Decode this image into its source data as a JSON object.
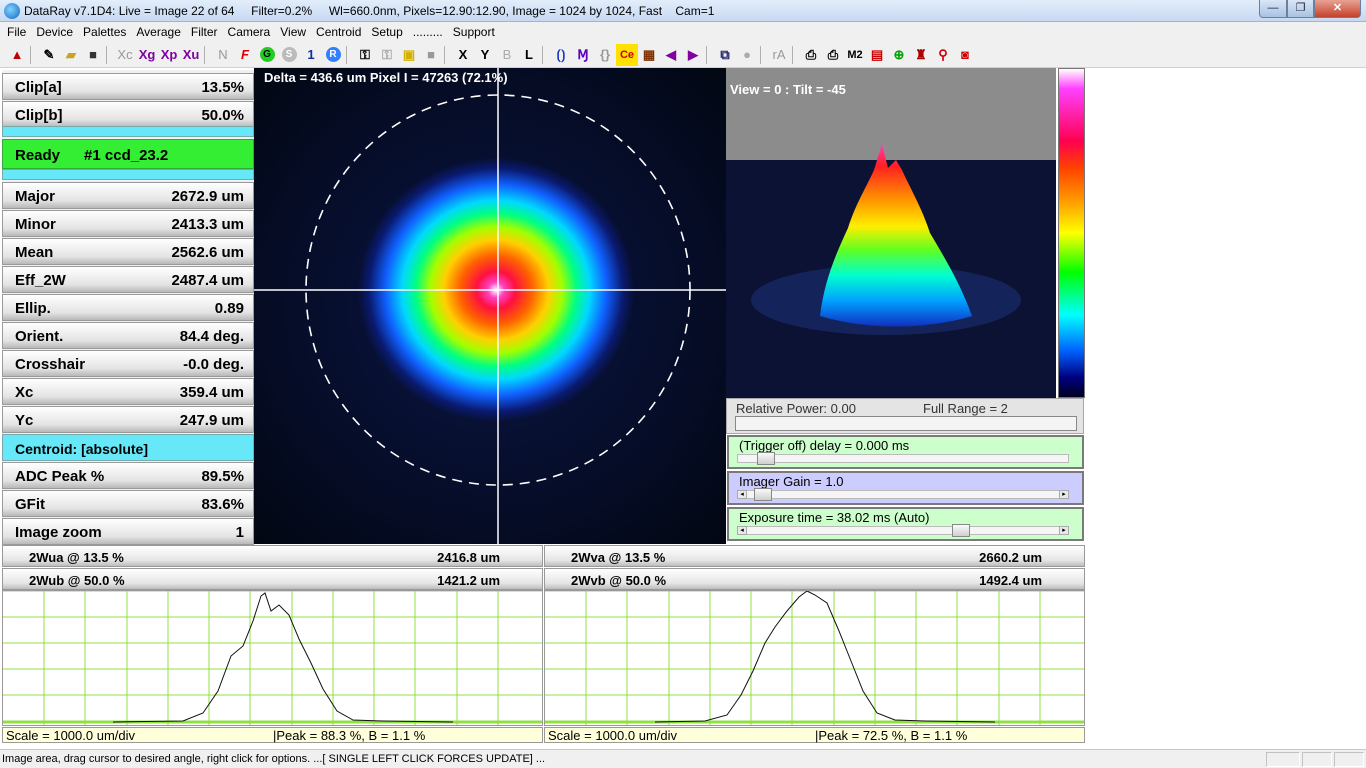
{
  "window": {
    "title": "DataRay v7.1D4: Live = Image 22 of 64     Filter=0.2%     Wl=660.0nm, Pixels=12.90:12.90, Image = 1024 by 1024, Fast    Cam=1",
    "min_label": "—",
    "max_label": "❐",
    "close_label": "✕"
  },
  "menu": [
    "File",
    "Device",
    "Palettes",
    "Average",
    "Filter",
    "Camera",
    "View",
    "Centroid",
    "Setup",
    ".........",
    "Support"
  ],
  "toolbar": {
    "xc": "Xc",
    "xg": "Xg",
    "xp": "Xp",
    "xu": "Xu",
    "n": "N",
    "f": "F",
    "g": "G",
    "s": "S",
    "one": "1",
    "r": "R",
    "x": "X",
    "y": "Y",
    "b": "B",
    "l": "L",
    "ce": "Ce",
    "ra": "rA",
    "m2": "M2"
  },
  "left_panel": {
    "clip_a": {
      "label": "Clip[a]",
      "value": "13.5%"
    },
    "clip_b": {
      "label": "Clip[b]",
      "value": "50.0%"
    },
    "status": {
      "label": "Ready",
      "value": "#1 ccd_23.2"
    },
    "major": {
      "label": "Major",
      "value": "2672.9 um"
    },
    "minor": {
      "label": "Minor",
      "value": "2413.3 um"
    },
    "mean": {
      "label": "Mean",
      "value": "2562.6 um"
    },
    "eff_2w": {
      "label": "Eff_2W",
      "value": "2487.4 um"
    },
    "ellip": {
      "label": "Ellip.",
      "value": "0.89"
    },
    "orient": {
      "label": "Orient.",
      "value": "84.4 deg."
    },
    "crosshair": {
      "label": "Crosshair",
      "value": "-0.0 deg."
    },
    "xc": {
      "label": "Xc",
      "value": "359.4 um"
    },
    "yc": {
      "label": "Yc",
      "value": "247.9 um"
    },
    "centroid": "Centroid: [absolute]",
    "adc_peak": {
      "label": "ADC Peak %",
      "value": "89.5%"
    },
    "gfit": {
      "label": "GFit",
      "value": "83.6%"
    },
    "image_zoom": {
      "label": "Image zoom",
      "value": "1"
    }
  },
  "beam": {
    "delta_text": "Delta = 436.6 um Pixel I = 47263 (72.1%)"
  },
  "view3d": {
    "label": "View = 0 : Tilt = -45"
  },
  "relative_power": {
    "label": "Relative Power: 0.00",
    "full_range": "Full Range = 2"
  },
  "controls": {
    "trigger": {
      "label": "(Trigger off) delay = 0.000 ms",
      "color": "#ccffcc",
      "position": 0.06
    },
    "gain": {
      "label": "Imager Gain = 1.0",
      "color": "#ccccff",
      "position": 0.05
    },
    "exposure": {
      "label": "Exposure time = 38.02 ms (Auto)",
      "color": "#ccffcc",
      "position": 0.68
    }
  },
  "profiles": {
    "u": {
      "wa_label": "2Wua @ 13.5 %",
      "wa_value": "2416.8 um",
      "wb_label": "2Wub @ 50.0 %",
      "wb_value": "1421.2 um",
      "scale": "Scale = 1000.0 um/div",
      "peak": "|Peak = 88.3 %,  B = 1.1 %"
    },
    "v": {
      "wa_label": "2Wva @ 13.5 %",
      "wa_value": "2660.2 um",
      "wb_label": "2Wvb @ 50.0 %",
      "wb_value": "1492.4 um",
      "scale": "Scale = 1000.0 um/div",
      "peak": "|Peak = 72.5 %,  B = 1.1 %"
    }
  },
  "status_text": "Image area, drag cursor to desired angle, right click for options. ...[ SINGLE LEFT CLICK FORCES UPDATE] ..."
}
